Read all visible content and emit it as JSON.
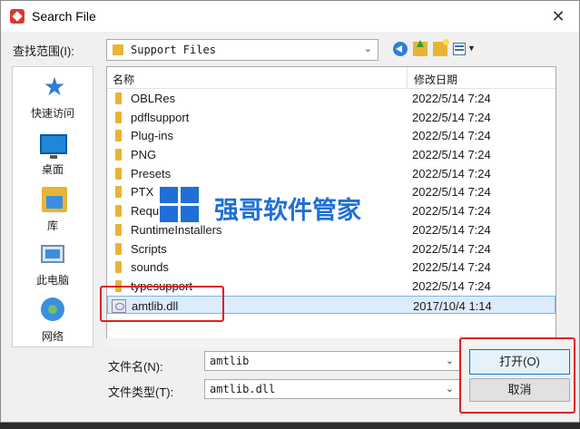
{
  "window": {
    "title": "Search File",
    "close_glyph": "✕"
  },
  "look_in": {
    "label": "查找范围(I):",
    "value": "Support Files"
  },
  "places": [
    {
      "name": "quick-access",
      "label": "快速访问"
    },
    {
      "name": "desktop",
      "label": "桌面"
    },
    {
      "name": "library",
      "label": "库"
    },
    {
      "name": "this-pc",
      "label": "此电脑"
    },
    {
      "name": "network",
      "label": "网络"
    }
  ],
  "file_list": {
    "columns": {
      "name": "名称",
      "date": "修改日期"
    },
    "rows": [
      {
        "name": "OBLRes",
        "date": "2022/5/14 7:24",
        "type": "folder"
      },
      {
        "name": "pdflsupport",
        "date": "2022/5/14 7:24",
        "type": "folder"
      },
      {
        "name": "Plug-ins",
        "date": "2022/5/14 7:24",
        "type": "folder"
      },
      {
        "name": "PNG",
        "date": "2022/5/14 7:24",
        "type": "folder"
      },
      {
        "name": "Presets",
        "date": "2022/5/14 7:24",
        "type": "folder"
      },
      {
        "name": "PTX",
        "date": "2022/5/14 7:24",
        "type": "folder"
      },
      {
        "name": "Required",
        "date": "2022/5/14 7:24",
        "type": "folder"
      },
      {
        "name": "RuntimeInstallers",
        "date": "2022/5/14 7:24",
        "type": "folder"
      },
      {
        "name": "Scripts",
        "date": "2022/5/14 7:24",
        "type": "folder"
      },
      {
        "name": "sounds",
        "date": "2022/5/14 7:24",
        "type": "folder"
      },
      {
        "name": "typesupport",
        "date": "2022/5/14 7:24",
        "type": "folder"
      },
      {
        "name": "amtlib.dll",
        "date": "2017/10/4 1:14",
        "type": "dll",
        "selected": true
      }
    ]
  },
  "file_name": {
    "label": "文件名(N):",
    "value": "amtlib"
  },
  "file_type": {
    "label": "文件类型(T):",
    "value": "amtlib.dll"
  },
  "buttons": {
    "open": "打开(O)",
    "cancel": "取消"
  },
  "watermark": {
    "text": "强哥软件管家"
  },
  "colors": {
    "accent": "#0078d7",
    "highlight": "#e0201a",
    "folder": "#e8b436",
    "selection": "#dcecfc",
    "watermark": "#1f6fd6"
  }
}
